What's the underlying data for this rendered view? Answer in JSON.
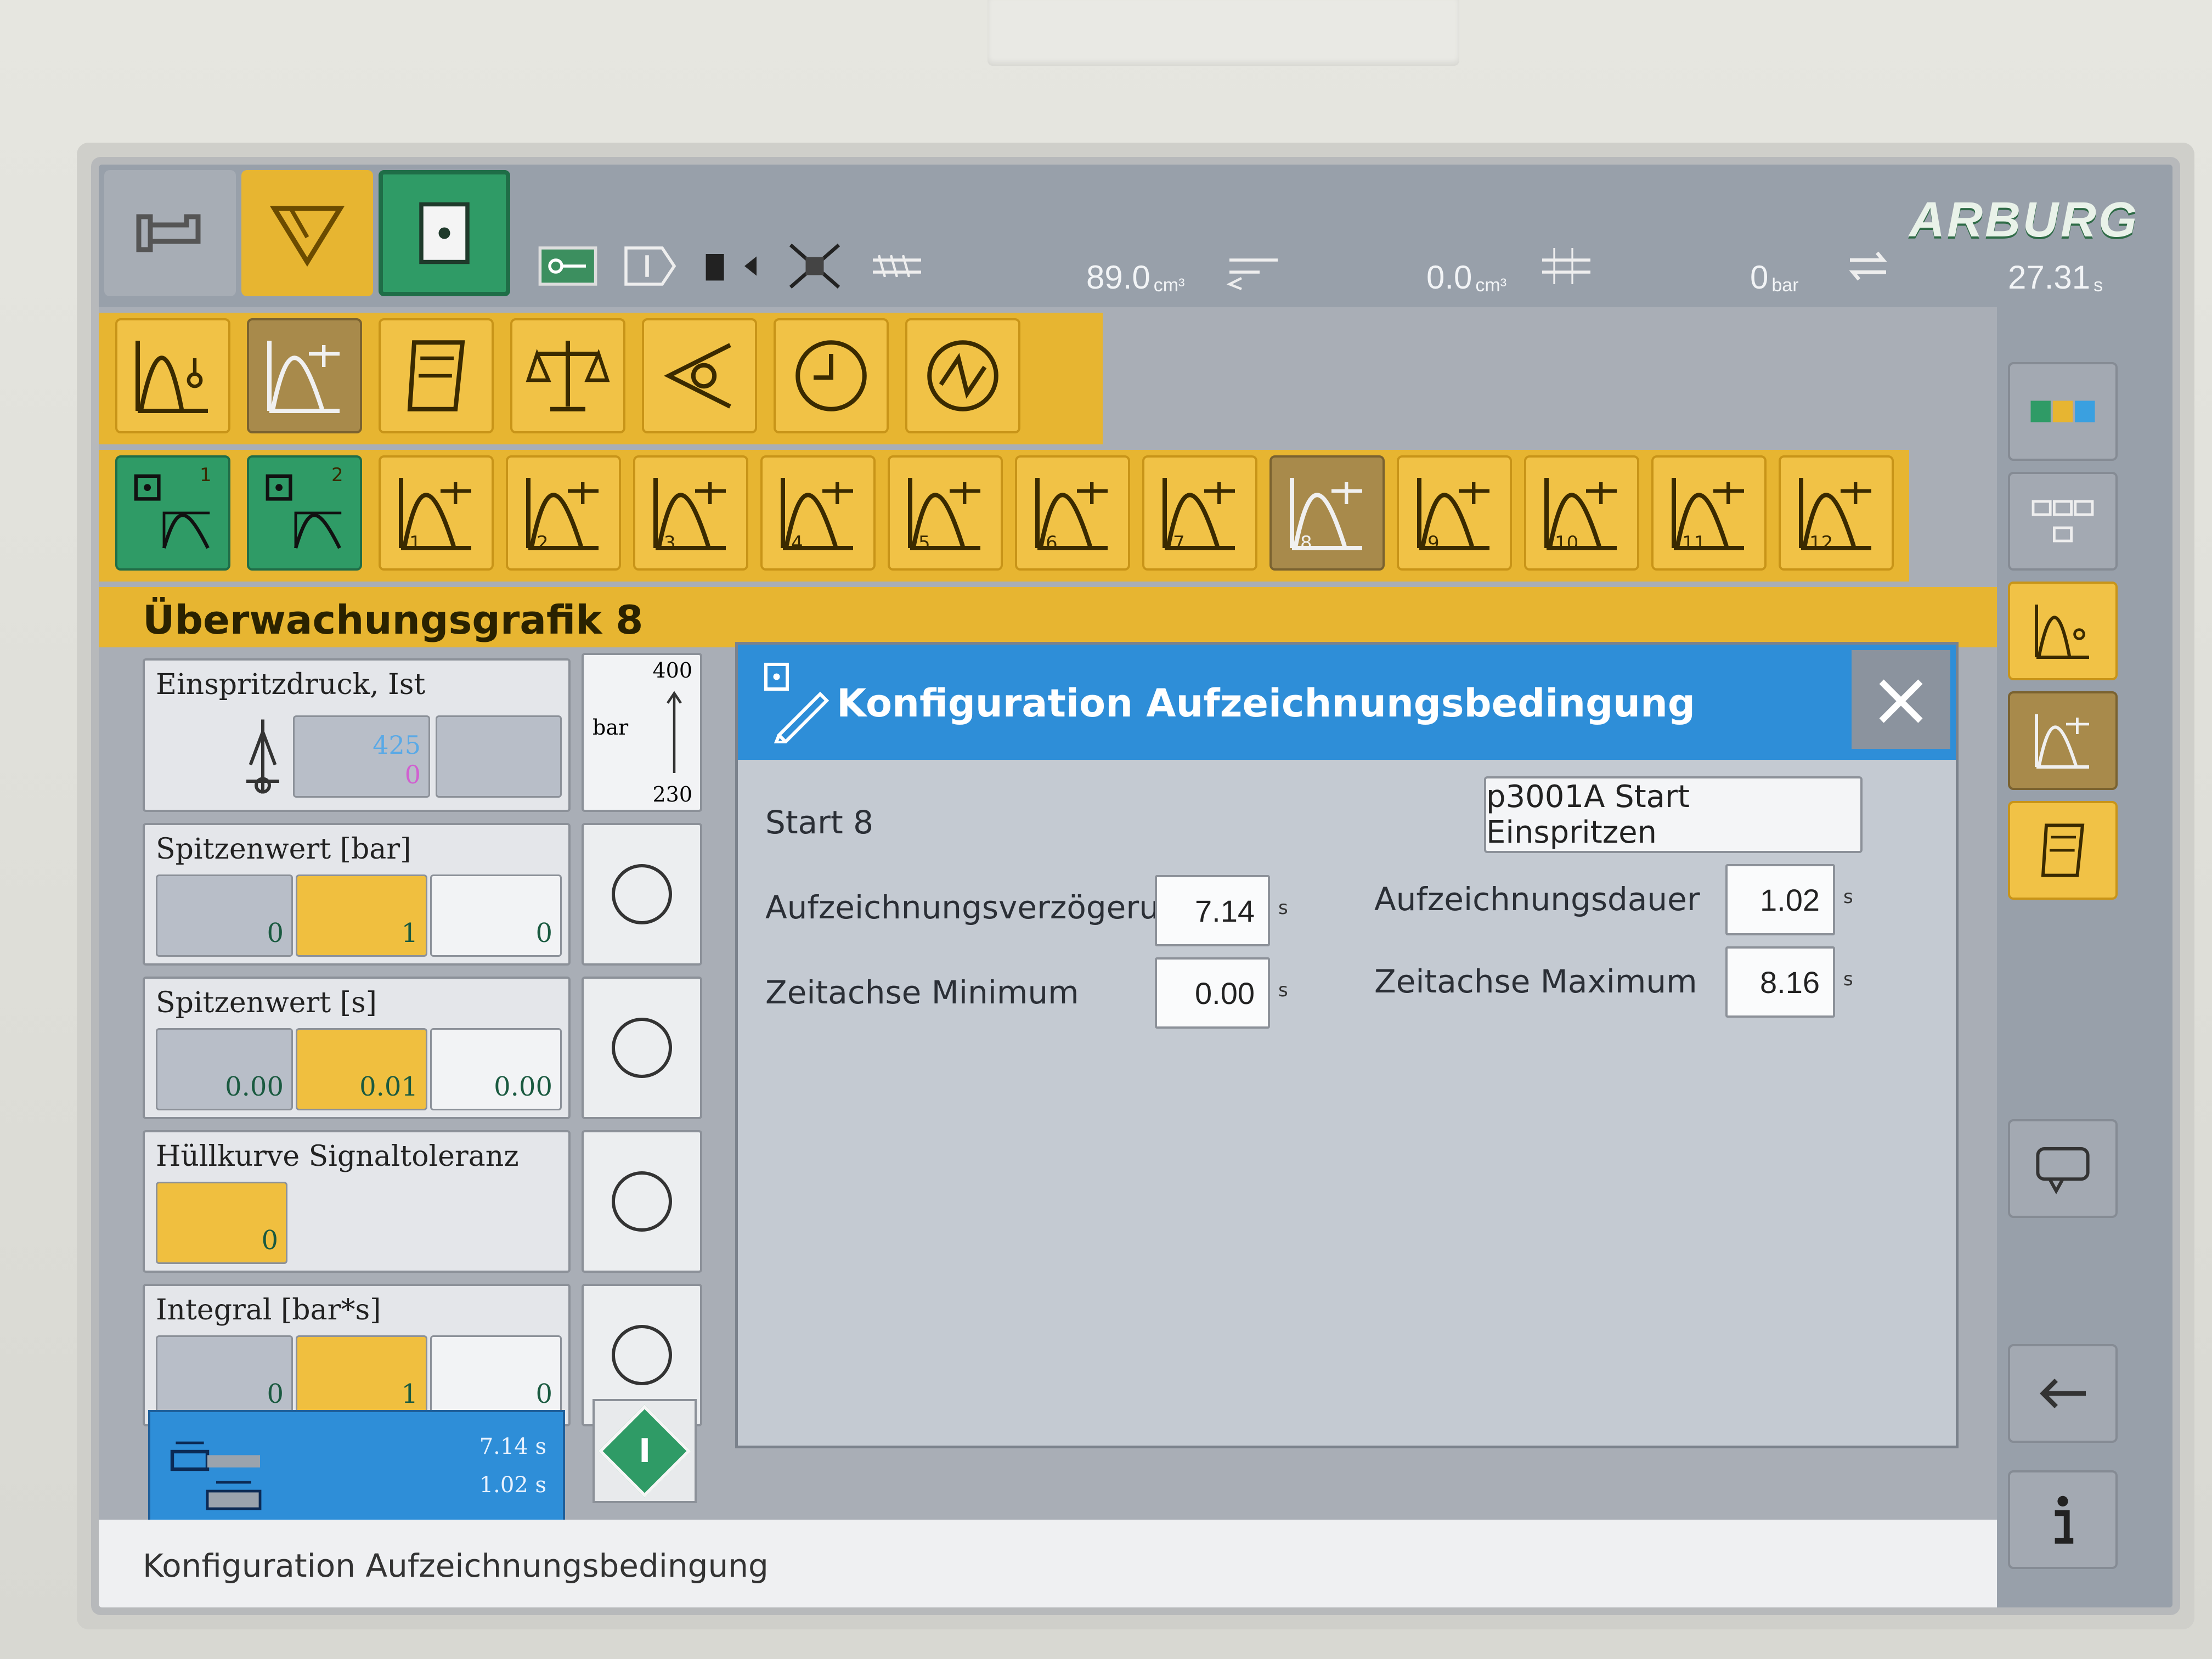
{
  "status_bar": {
    "brand": "ARBURG",
    "metering_volume": "89.0",
    "metering_unit": "cm³",
    "cushion_volume": "0.0",
    "cushion_unit": "cm³",
    "pressure": "0",
    "pressure_unit": "bar",
    "cycle_time": "27.31",
    "cycle_unit": "s"
  },
  "toolbar_row2": {
    "buttons": [
      "1",
      "2",
      "3",
      "4",
      "5",
      "6",
      "7",
      "8",
      "9",
      "10",
      "11",
      "12"
    ],
    "green_labels": [
      "1",
      "2"
    ],
    "active": "8"
  },
  "page": {
    "title": "Überwachungsgrafik 8"
  },
  "monitor": {
    "einspritzdruck": {
      "label": "Einspritzdruck, Ist",
      "value_top": "425",
      "value_bottom": "0",
      "unit": "bar",
      "scale_max": "400",
      "scale_min": "230"
    },
    "spitzenwert_bar": {
      "label": "Spitzenwert [bar]",
      "v1": "0",
      "v2": "1",
      "v3": "0"
    },
    "spitzenwert_s": {
      "label": "Spitzenwert [s]",
      "v1": "0.00",
      "v2": "0.01",
      "v3": "0.00"
    },
    "huellkurve": {
      "label": "Hüllkurve Signaltoleranz",
      "v1": "0"
    },
    "integral": {
      "label": "Integral [bar*s]",
      "v1": "0",
      "v2": "1",
      "v3": "0"
    },
    "summary": {
      "delay": "7.14 s",
      "duration": "1.02 s"
    }
  },
  "dialog": {
    "title": "Konfiguration Aufzeichnungsbedingung",
    "start_label": "Start 8",
    "start_value": "p3001A Start Einspritzen",
    "delay_label": "Aufzeichnungsverzögerung",
    "delay_value": "7.14",
    "duration_label": "Aufzeichnungsdauer",
    "duration_value": "1.02",
    "tmin_label": "Zeitachse Minimum",
    "tmin_value": "0.00",
    "tmax_label": "Zeitachse Maximum",
    "tmax_value": "8.16",
    "unit": "s"
  },
  "footer": {
    "text": "Konfiguration Aufzeichnungsbedingung"
  },
  "colors": {
    "accent_yellow": "#e7b531",
    "accent_green": "#2f9b66",
    "dialog_blue": "#2e8ed8"
  }
}
